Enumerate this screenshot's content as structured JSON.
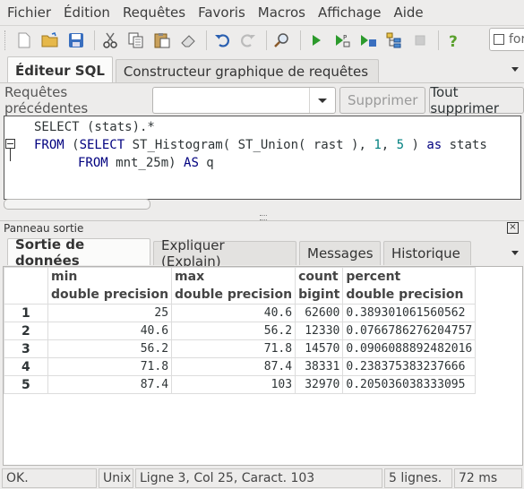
{
  "menu": [
    "Fichier",
    "Édition",
    "Requêtes",
    "Favoris",
    "Macros",
    "Affichage",
    "Aide"
  ],
  "toolbar": {
    "icons": [
      "new-file-icon",
      "open-folder-icon",
      "save-icon",
      "cut-icon",
      "copy-icon",
      "paste-icon",
      "eraser-icon",
      "undo-icon",
      "redo-icon",
      "find-icon",
      "execute-icon",
      "execute-pgscript-icon",
      "execute-to-file-icon",
      "explain-icon",
      "cancel-query-icon",
      "help-icon"
    ],
    "search_text": "for"
  },
  "editor_tabs": [
    "Éditeur SQL",
    "Constructeur graphique de requêtes"
  ],
  "history": {
    "label": "Requêtes précédentes",
    "selected": "",
    "delete_label": "Supprimer",
    "delete_all_label": "Tout supprimer"
  },
  "sql": {
    "line1": "SELECT (stats).*",
    "line2_kw1": "FROM",
    "line2_a": " (",
    "line2_kw2": "SELECT",
    "line2_b": " ST_Histogram( ST_Union( rast ), ",
    "line2_n1": "1",
    "line2_c": ", ",
    "line2_n2": "5",
    "line2_d": " ) ",
    "line2_kw3": "as",
    "line2_e": " stats",
    "line3_kw1": "FROM",
    "line3_a": " mnt_25m) ",
    "line3_kw2": "AS",
    "line3_b": " q"
  },
  "output": {
    "title": "Panneau sortie",
    "tabs": [
      "Sortie de données",
      "Expliquer (Explain)",
      "Messages",
      "Historique"
    ],
    "columns": [
      {
        "name": "min",
        "type": "double precision"
      },
      {
        "name": "max",
        "type": "double precision"
      },
      {
        "name": "count",
        "type": "bigint"
      },
      {
        "name": "percent",
        "type": "double precision"
      }
    ],
    "rows": [
      {
        "n": "1",
        "min": "25",
        "max": "40.6",
        "count": "62600",
        "percent": "0.389301061560562"
      },
      {
        "n": "2",
        "min": "40.6",
        "max": "56.2",
        "count": "12330",
        "percent": "0.0766786276204757"
      },
      {
        "n": "3",
        "min": "56.2",
        "max": "71.8",
        "count": "14570",
        "percent": "0.0906088892482016"
      },
      {
        "n": "4",
        "min": "71.8",
        "max": "87.4",
        "count": "38331",
        "percent": "0.238375383237666"
      },
      {
        "n": "5",
        "min": "87.4",
        "max": "103",
        "count": "32970",
        "percent": "0.205036038333095"
      }
    ]
  },
  "status": {
    "state": "OK.",
    "eol": "Unix",
    "position": "Ligne 3, Col 25, Caract. 103",
    "rows": "5 lignes.",
    "time": "72 ms"
  }
}
